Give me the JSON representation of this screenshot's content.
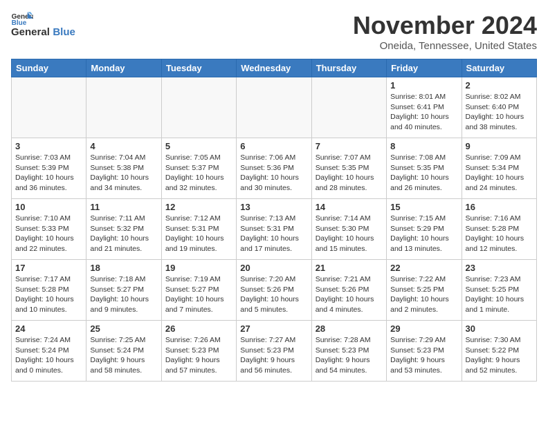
{
  "header": {
    "logo_general": "General",
    "logo_blue": "Blue",
    "month": "November 2024",
    "location": "Oneida, Tennessee, United States"
  },
  "weekdays": [
    "Sunday",
    "Monday",
    "Tuesday",
    "Wednesday",
    "Thursday",
    "Friday",
    "Saturday"
  ],
  "weeks": [
    [
      {
        "day": "",
        "info": ""
      },
      {
        "day": "",
        "info": ""
      },
      {
        "day": "",
        "info": ""
      },
      {
        "day": "",
        "info": ""
      },
      {
        "day": "",
        "info": ""
      },
      {
        "day": "1",
        "info": "Sunrise: 8:01 AM\nSunset: 6:41 PM\nDaylight: 10 hours\nand 40 minutes."
      },
      {
        "day": "2",
        "info": "Sunrise: 8:02 AM\nSunset: 6:40 PM\nDaylight: 10 hours\nand 38 minutes."
      }
    ],
    [
      {
        "day": "3",
        "info": "Sunrise: 7:03 AM\nSunset: 5:39 PM\nDaylight: 10 hours\nand 36 minutes."
      },
      {
        "day": "4",
        "info": "Sunrise: 7:04 AM\nSunset: 5:38 PM\nDaylight: 10 hours\nand 34 minutes."
      },
      {
        "day": "5",
        "info": "Sunrise: 7:05 AM\nSunset: 5:37 PM\nDaylight: 10 hours\nand 32 minutes."
      },
      {
        "day": "6",
        "info": "Sunrise: 7:06 AM\nSunset: 5:36 PM\nDaylight: 10 hours\nand 30 minutes."
      },
      {
        "day": "7",
        "info": "Sunrise: 7:07 AM\nSunset: 5:35 PM\nDaylight: 10 hours\nand 28 minutes."
      },
      {
        "day": "8",
        "info": "Sunrise: 7:08 AM\nSunset: 5:35 PM\nDaylight: 10 hours\nand 26 minutes."
      },
      {
        "day": "9",
        "info": "Sunrise: 7:09 AM\nSunset: 5:34 PM\nDaylight: 10 hours\nand 24 minutes."
      }
    ],
    [
      {
        "day": "10",
        "info": "Sunrise: 7:10 AM\nSunset: 5:33 PM\nDaylight: 10 hours\nand 22 minutes."
      },
      {
        "day": "11",
        "info": "Sunrise: 7:11 AM\nSunset: 5:32 PM\nDaylight: 10 hours\nand 21 minutes."
      },
      {
        "day": "12",
        "info": "Sunrise: 7:12 AM\nSunset: 5:31 PM\nDaylight: 10 hours\nand 19 minutes."
      },
      {
        "day": "13",
        "info": "Sunrise: 7:13 AM\nSunset: 5:31 PM\nDaylight: 10 hours\nand 17 minutes."
      },
      {
        "day": "14",
        "info": "Sunrise: 7:14 AM\nSunset: 5:30 PM\nDaylight: 10 hours\nand 15 minutes."
      },
      {
        "day": "15",
        "info": "Sunrise: 7:15 AM\nSunset: 5:29 PM\nDaylight: 10 hours\nand 13 minutes."
      },
      {
        "day": "16",
        "info": "Sunrise: 7:16 AM\nSunset: 5:28 PM\nDaylight: 10 hours\nand 12 minutes."
      }
    ],
    [
      {
        "day": "17",
        "info": "Sunrise: 7:17 AM\nSunset: 5:28 PM\nDaylight: 10 hours\nand 10 minutes."
      },
      {
        "day": "18",
        "info": "Sunrise: 7:18 AM\nSunset: 5:27 PM\nDaylight: 10 hours\nand 9 minutes."
      },
      {
        "day": "19",
        "info": "Sunrise: 7:19 AM\nSunset: 5:27 PM\nDaylight: 10 hours\nand 7 minutes."
      },
      {
        "day": "20",
        "info": "Sunrise: 7:20 AM\nSunset: 5:26 PM\nDaylight: 10 hours\nand 5 minutes."
      },
      {
        "day": "21",
        "info": "Sunrise: 7:21 AM\nSunset: 5:26 PM\nDaylight: 10 hours\nand 4 minutes."
      },
      {
        "day": "22",
        "info": "Sunrise: 7:22 AM\nSunset: 5:25 PM\nDaylight: 10 hours\nand 2 minutes."
      },
      {
        "day": "23",
        "info": "Sunrise: 7:23 AM\nSunset: 5:25 PM\nDaylight: 10 hours\nand 1 minute."
      }
    ],
    [
      {
        "day": "24",
        "info": "Sunrise: 7:24 AM\nSunset: 5:24 PM\nDaylight: 10 hours\nand 0 minutes."
      },
      {
        "day": "25",
        "info": "Sunrise: 7:25 AM\nSunset: 5:24 PM\nDaylight: 9 hours\nand 58 minutes."
      },
      {
        "day": "26",
        "info": "Sunrise: 7:26 AM\nSunset: 5:23 PM\nDaylight: 9 hours\nand 57 minutes."
      },
      {
        "day": "27",
        "info": "Sunrise: 7:27 AM\nSunset: 5:23 PM\nDaylight: 9 hours\nand 56 minutes."
      },
      {
        "day": "28",
        "info": "Sunrise: 7:28 AM\nSunset: 5:23 PM\nDaylight: 9 hours\nand 54 minutes."
      },
      {
        "day": "29",
        "info": "Sunrise: 7:29 AM\nSunset: 5:23 PM\nDaylight: 9 hours\nand 53 minutes."
      },
      {
        "day": "30",
        "info": "Sunrise: 7:30 AM\nSunset: 5:22 PM\nDaylight: 9 hours\nand 52 minutes."
      }
    ]
  ]
}
